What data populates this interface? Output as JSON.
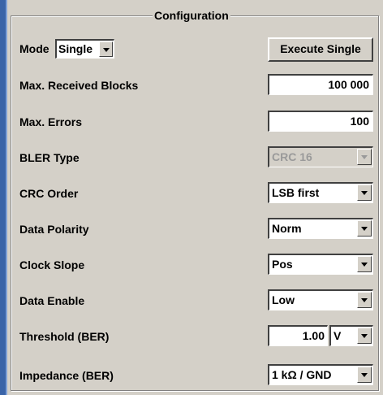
{
  "panel": {
    "title": "Configuration"
  },
  "mode": {
    "label": "Mode",
    "value": "Single"
  },
  "execute": {
    "label": "Execute Single"
  },
  "max_received_blocks": {
    "label": "Max. Received Blocks",
    "value": "100 000"
  },
  "max_errors": {
    "label": "Max. Errors",
    "value": "100"
  },
  "bler_type": {
    "label": "BLER Type",
    "value": "CRC 16"
  },
  "crc_order": {
    "label": "CRC Order",
    "value": "LSB first"
  },
  "data_polarity": {
    "label": "Data Polarity",
    "value": "Norm"
  },
  "clock_slope": {
    "label": "Clock Slope",
    "value": "Pos"
  },
  "data_enable": {
    "label": "Data Enable",
    "value": "Low"
  },
  "threshold": {
    "label": "Threshold (BER)",
    "value": "1.00",
    "unit": "V"
  },
  "impedance": {
    "label": "Impedance (BER)",
    "value": "1 kΩ / GND"
  }
}
